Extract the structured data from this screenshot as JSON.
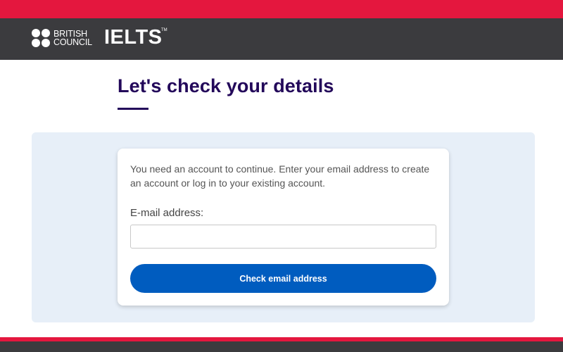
{
  "header": {
    "brand_line1": "BRITISH",
    "brand_line2": "COUNCIL",
    "product_logo": "IELTS",
    "trademark": "TM"
  },
  "main": {
    "title": "Let's check your details",
    "intro_text": "You need an account to continue. Enter your email address to create an account or log in to your existing account.",
    "email_label": "E-mail address:",
    "email_value": "",
    "email_placeholder": "",
    "submit_label": "Check email address"
  },
  "colors": {
    "accent_red": "#e4173e",
    "header_dark": "#3b3b3e",
    "title_purple": "#23085a",
    "panel_background": "#e7eff8",
    "button_blue": "#005cbf"
  },
  "icons": {
    "brand_mark": "british-council-dots-icon"
  }
}
